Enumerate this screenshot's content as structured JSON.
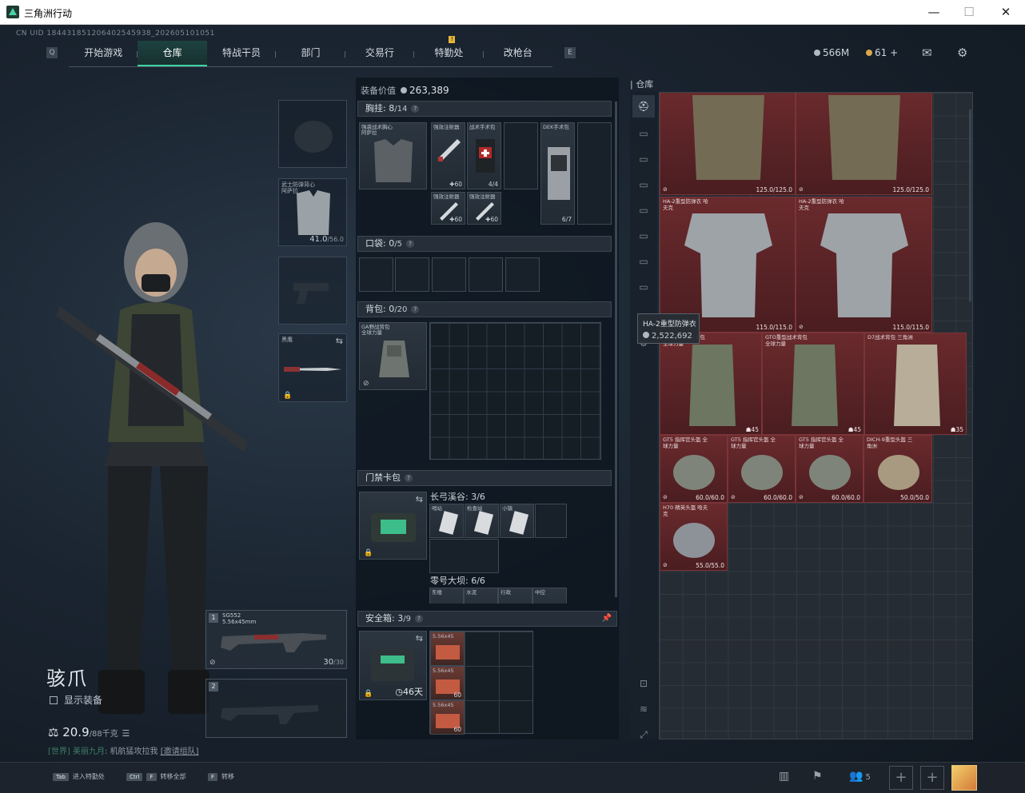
{
  "window": {
    "title": "三角洲行动",
    "min": "—",
    "max": "☐",
    "close": "✕"
  },
  "uid": "CN UID 184431851206402545938_202605101051",
  "nav": {
    "tabs": [
      "开始游戏",
      "仓库",
      "特战干员",
      "部门",
      "交易行",
      "特勤处",
      "改枪台"
    ],
    "active": "仓库",
    "mini_left": "Q",
    "mini_right": "E",
    "badge": "!"
  },
  "currency": {
    "silver": "566M",
    "gold": "61",
    "plus": "+"
  },
  "icons": {
    "mail": "✉",
    "settings": "⚙"
  },
  "character": {
    "name": "骇爪",
    "show_equip": "显示装备",
    "weight": "20.9",
    "weight_max": "/88千克"
  },
  "chat": {
    "channel": "[世界]",
    "user": "美丽九月",
    "msg": "机航猛攻拉我",
    "link": "[邀请组队]"
  },
  "equip": {
    "armor_name": "武士防弹背心 阿萨拉",
    "armor_dur": "41.0",
    "armor_dur_max": "/56.0",
    "melee_name": "黑鹰",
    "primary": {
      "num": "1",
      "name": "SG552",
      "caliber": "5.56x45mm",
      "ammo": "30",
      "ammo_max": "/30"
    },
    "secondary": {
      "num": "2"
    }
  },
  "mid": {
    "equip_value_label": "装备价值",
    "equip_value": "263,389",
    "chest": {
      "label": "胸挂:",
      "count": "8",
      "max": "/14"
    },
    "chest_items": {
      "rig": "强袭战术胸心 阿萨拉",
      "inj1": "强效注射器",
      "inj1_amt": "60",
      "medkit": "战术手术包",
      "medkit_amt": "4/4",
      "dek": "DEK手术包",
      "dek_amt": "6/7",
      "inj2": "强效注射器",
      "inj2_amt": "60",
      "inj3": "强效注射器",
      "inj3_amt": "60"
    },
    "pocket": {
      "label": "口袋:",
      "count": "0",
      "max": "/5"
    },
    "backpack": {
      "label": "背包:",
      "count": "0",
      "max": "/20",
      "item": "GA野战背包 全球力量"
    },
    "keycard": {
      "label": "门禁卡包",
      "map1": "长弓溪谷:",
      "map1_cnt": "3/6",
      "map1_cards": [
        "哨站",
        "检查站",
        "小镇"
      ],
      "map2": "零号大坝:",
      "map2_cnt": "6/6",
      "map2_cards": [
        "东楼",
        "水泥",
        "行政",
        "中控"
      ]
    },
    "safebox": {
      "label": "安全箱:",
      "count": "3",
      "max": "/9",
      "timer": "46天",
      "ammo": [
        {
          "name": "5.56x45",
          "amt": ""
        },
        {
          "name": "5.56x45",
          "amt": "60"
        },
        {
          "name": "5.56x45",
          "amt": "60"
        }
      ]
    }
  },
  "warehouse": {
    "title": "仓库",
    "items": [
      {
        "name": "",
        "dur": "125.0/125.0"
      },
      {
        "name": "",
        "dur": "125.0/125.0"
      },
      {
        "name": "HA-2重型防弹衣 哈夫克",
        "dur": "115.0/115.0"
      },
      {
        "name": "HA-2重型防弹衣 哈夫克",
        "dur": "115.0/115.0"
      },
      {
        "name": "GTO重型战术背包 全球力量",
        "dur": "45"
      },
      {
        "name": "GTO重型战术背包 全球力量",
        "dur": "45"
      },
      {
        "name": "D7战术背包 三角洲",
        "dur": "35"
      },
      {
        "name": "GT5 指挥官头盔 全球力量",
        "dur": "60.0/60.0"
      },
      {
        "name": "GT5 指挥官头盔 全球力量",
        "dur": "60.0/60.0"
      },
      {
        "name": "GT5 指挥官头盔 全球力量",
        "dur": "60.0/60.0"
      },
      {
        "name": "DICH-9重型头盔 三角洲",
        "dur": "50.0/50.0"
      },
      {
        "name": "H70 精英头盔 哈夫克",
        "dur": "55.0/55.0"
      }
    ],
    "tooltip": {
      "name": "HA-2重型防弹衣",
      "price": "2,522,692"
    }
  },
  "bottom": {
    "hints": [
      {
        "key": "Tab",
        "label": "进入特勤处"
      },
      {
        "key": "Ctrl",
        "key2": "F",
        "label": "转移全部"
      },
      {
        "key": "F",
        "label": "转移"
      }
    ],
    "friends": "5"
  },
  "colors": {
    "accent": "#40d0a6",
    "item_red": "#6a2a2d",
    "bg": "#0f1822"
  }
}
